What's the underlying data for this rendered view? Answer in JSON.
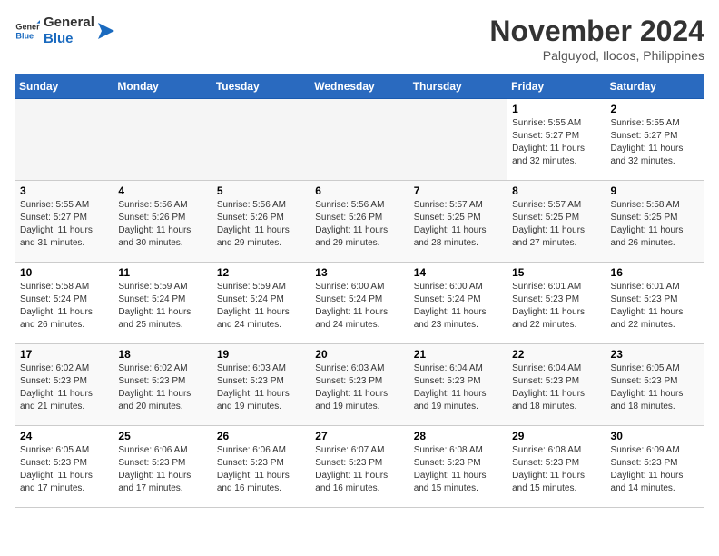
{
  "logo": {
    "line1": "General",
    "line2": "Blue"
  },
  "title": "November 2024",
  "location": "Palguyod, Ilocos, Philippines",
  "days_of_week": [
    "Sunday",
    "Monday",
    "Tuesday",
    "Wednesday",
    "Thursday",
    "Friday",
    "Saturday"
  ],
  "weeks": [
    [
      {
        "day": "",
        "empty": true
      },
      {
        "day": "",
        "empty": true
      },
      {
        "day": "",
        "empty": true
      },
      {
        "day": "",
        "empty": true
      },
      {
        "day": "",
        "empty": true
      },
      {
        "day": "1",
        "sunrise": "5:55 AM",
        "sunset": "5:27 PM",
        "daylight": "11 hours and 32 minutes."
      },
      {
        "day": "2",
        "sunrise": "5:55 AM",
        "sunset": "5:27 PM",
        "daylight": "11 hours and 32 minutes."
      }
    ],
    [
      {
        "day": "3",
        "sunrise": "5:55 AM",
        "sunset": "5:27 PM",
        "daylight": "11 hours and 31 minutes."
      },
      {
        "day": "4",
        "sunrise": "5:56 AM",
        "sunset": "5:26 PM",
        "daylight": "11 hours and 30 minutes."
      },
      {
        "day": "5",
        "sunrise": "5:56 AM",
        "sunset": "5:26 PM",
        "daylight": "11 hours and 29 minutes."
      },
      {
        "day": "6",
        "sunrise": "5:56 AM",
        "sunset": "5:26 PM",
        "daylight": "11 hours and 29 minutes."
      },
      {
        "day": "7",
        "sunrise": "5:57 AM",
        "sunset": "5:25 PM",
        "daylight": "11 hours and 28 minutes."
      },
      {
        "day": "8",
        "sunrise": "5:57 AM",
        "sunset": "5:25 PM",
        "daylight": "11 hours and 27 minutes."
      },
      {
        "day": "9",
        "sunrise": "5:58 AM",
        "sunset": "5:25 PM",
        "daylight": "11 hours and 26 minutes."
      }
    ],
    [
      {
        "day": "10",
        "sunrise": "5:58 AM",
        "sunset": "5:24 PM",
        "daylight": "11 hours and 26 minutes."
      },
      {
        "day": "11",
        "sunrise": "5:59 AM",
        "sunset": "5:24 PM",
        "daylight": "11 hours and 25 minutes."
      },
      {
        "day": "12",
        "sunrise": "5:59 AM",
        "sunset": "5:24 PM",
        "daylight": "11 hours and 24 minutes."
      },
      {
        "day": "13",
        "sunrise": "6:00 AM",
        "sunset": "5:24 PM",
        "daylight": "11 hours and 24 minutes."
      },
      {
        "day": "14",
        "sunrise": "6:00 AM",
        "sunset": "5:24 PM",
        "daylight": "11 hours and 23 minutes."
      },
      {
        "day": "15",
        "sunrise": "6:01 AM",
        "sunset": "5:23 PM",
        "daylight": "11 hours and 22 minutes."
      },
      {
        "day": "16",
        "sunrise": "6:01 AM",
        "sunset": "5:23 PM",
        "daylight": "11 hours and 22 minutes."
      }
    ],
    [
      {
        "day": "17",
        "sunrise": "6:02 AM",
        "sunset": "5:23 PM",
        "daylight": "11 hours and 21 minutes."
      },
      {
        "day": "18",
        "sunrise": "6:02 AM",
        "sunset": "5:23 PM",
        "daylight": "11 hours and 20 minutes."
      },
      {
        "day": "19",
        "sunrise": "6:03 AM",
        "sunset": "5:23 PM",
        "daylight": "11 hours and 19 minutes."
      },
      {
        "day": "20",
        "sunrise": "6:03 AM",
        "sunset": "5:23 PM",
        "daylight": "11 hours and 19 minutes."
      },
      {
        "day": "21",
        "sunrise": "6:04 AM",
        "sunset": "5:23 PM",
        "daylight": "11 hours and 19 minutes."
      },
      {
        "day": "22",
        "sunrise": "6:04 AM",
        "sunset": "5:23 PM",
        "daylight": "11 hours and 18 minutes."
      },
      {
        "day": "23",
        "sunrise": "6:05 AM",
        "sunset": "5:23 PM",
        "daylight": "11 hours and 18 minutes."
      }
    ],
    [
      {
        "day": "24",
        "sunrise": "6:05 AM",
        "sunset": "5:23 PM",
        "daylight": "11 hours and 17 minutes."
      },
      {
        "day": "25",
        "sunrise": "6:06 AM",
        "sunset": "5:23 PM",
        "daylight": "11 hours and 17 minutes."
      },
      {
        "day": "26",
        "sunrise": "6:06 AM",
        "sunset": "5:23 PM",
        "daylight": "11 hours and 16 minutes."
      },
      {
        "day": "27",
        "sunrise": "6:07 AM",
        "sunset": "5:23 PM",
        "daylight": "11 hours and 16 minutes."
      },
      {
        "day": "28",
        "sunrise": "6:08 AM",
        "sunset": "5:23 PM",
        "daylight": "11 hours and 15 minutes."
      },
      {
        "day": "29",
        "sunrise": "6:08 AM",
        "sunset": "5:23 PM",
        "daylight": "11 hours and 15 minutes."
      },
      {
        "day": "30",
        "sunrise": "6:09 AM",
        "sunset": "5:23 PM",
        "daylight": "11 hours and 14 minutes."
      }
    ]
  ]
}
